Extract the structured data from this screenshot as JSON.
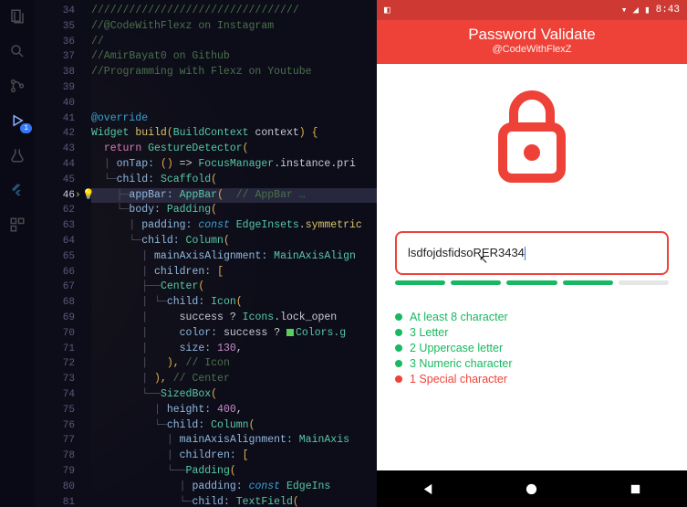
{
  "editor": {
    "line_numbers": [
      34,
      35,
      36,
      37,
      38,
      39,
      40,
      41,
      42,
      43,
      44,
      45,
      46,
      62,
      63,
      64,
      65,
      66,
      67,
      68,
      69,
      70,
      71,
      72,
      73,
      74,
      75,
      76,
      77,
      78,
      79,
      80,
      81
    ],
    "current_line": 46,
    "bulb_line": 46,
    "code": {
      "l34": "/////////////////////////////////",
      "l35": "//@CodeWithFlexz on Instagram",
      "l36": "//",
      "l37": "//AmirBayat0 on Github",
      "l38": "//Programming with Flexz on Youtube",
      "l41": "@override",
      "l42_kw": "Widget ",
      "l42_fn": "build",
      "l42_sig": "(BuildContext context) {",
      "l43_kw": "return ",
      "l43_t": "GestureDetector",
      "l44": "onTap: () => FocusManager.instance.pri",
      "l45_p": "child: ",
      "l45_t": "Scaffold",
      "l46_p": "appBar: ",
      "l46_t": "AppBar",
      "l46_cm": "// AppBar …",
      "l62_p": "body: ",
      "l62_t": "Padding",
      "l63": "padding: const EdgeInsets.symmetric",
      "l64_p": "child: ",
      "l64_t": "Column",
      "l65": "mainAxisAlignment: MainAxisAlign",
      "l66": "children: [",
      "l67_t": "Center",
      "l68_p": "child: ",
      "l68_t": "Icon",
      "l69": "success ? Icons.lock_open ",
      "l70": "color: success ? ",
      "l70_c": "Colors.g",
      "l71": "size: ",
      "l71_n": "130",
      "l72": "), ",
      "l72_cm": "// Icon",
      "l73": "), ",
      "l73_cm": "// Center",
      "l74_t": "SizedBox",
      "l75": "height: ",
      "l75_n": "400",
      "l76_p": "child: ",
      "l76_t": "Column",
      "l77": "mainAxisAlignment: MainAxis",
      "l78": "children: [",
      "l79_t": "Padding",
      "l80": "padding: const EdgeIns",
      "l81_p": "child: ",
      "l81_t": "TextField"
    }
  },
  "activity": {
    "debug_badge": "1"
  },
  "phone": {
    "status": {
      "time": "8:43"
    },
    "appbar": {
      "title": "Password Validate",
      "subtitle": "@CodeWithFlexZ"
    },
    "password_value": "lsdfojdsfidsoRER3434",
    "strength_segments": [
      true,
      true,
      true,
      true,
      false
    ],
    "rules": [
      {
        "ok": true,
        "text": "At least 8 character"
      },
      {
        "ok": true,
        "text": "3 Letter"
      },
      {
        "ok": true,
        "text": "2 Uppercase letter"
      },
      {
        "ok": true,
        "text": "3 Numeric character"
      },
      {
        "ok": false,
        "text": "1 Special character"
      }
    ]
  }
}
